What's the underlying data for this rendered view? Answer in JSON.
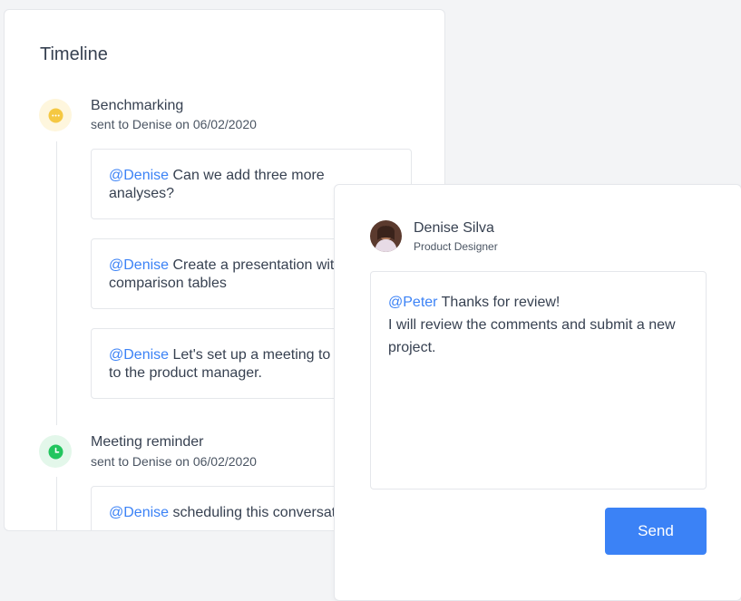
{
  "timeline": {
    "title": "Timeline",
    "events": [
      {
        "title": "Benchmarking",
        "subtitle": "sent to Denise on 06/02/2020",
        "icon": "comment-icon",
        "icon_color": "#f5c842",
        "messages": [
          {
            "mention": "@Denise",
            "text": "Can we add three more analyses?"
          },
          {
            "mention": "@Denise",
            "text": "Create a presentation with comparison tables"
          },
          {
            "mention": "@Denise",
            "text": "Let's set up a meeting to present to the product manager."
          }
        ]
      },
      {
        "title": "Meeting reminder",
        "subtitle": "sent to Denise on 06/02/2020",
        "icon": "clock-icon",
        "icon_color": "#22c55e",
        "messages": [
          {
            "mention": "@Denise",
            "text": "scheduling this conversation"
          }
        ]
      }
    ]
  },
  "reply": {
    "user_name": "Denise Silva",
    "user_role": "Product Designer",
    "mention": "@Peter",
    "line1": "Thanks for review!",
    "line2": "I will review the comments and submit a new project.",
    "send_label": "Send"
  },
  "colors": {
    "accent": "#3b82f6",
    "mention": "#3b82f6"
  }
}
